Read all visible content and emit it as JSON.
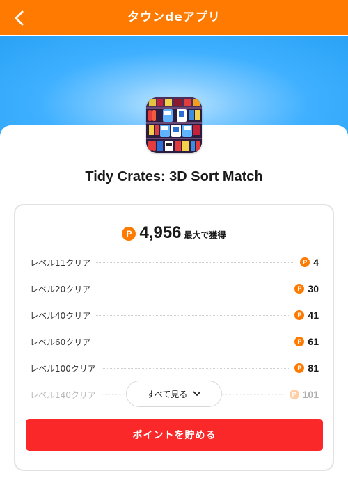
{
  "header": {
    "title": "タウンdeアプリ",
    "back_icon": "chevron-left-icon",
    "color": "#ff7a00"
  },
  "app": {
    "name": "Tidy Crates: 3D Sort Match",
    "icon": "app-icon"
  },
  "reward": {
    "total": "4,956",
    "total_suffix": "最大で獲得",
    "coin_label": "P",
    "coin_color": "#ff7a00",
    "items": [
      {
        "label": "レベル11クリア",
        "points": "4"
      },
      {
        "label": "レベル20クリア",
        "points": "30"
      },
      {
        "label": "レベル40クリア",
        "points": "41"
      },
      {
        "label": "レベル60クリア",
        "points": "61"
      },
      {
        "label": "レベル100クリア",
        "points": "81"
      },
      {
        "label": "レベル140クリア",
        "points": "101"
      }
    ]
  },
  "actions": {
    "see_all": "すべて見る",
    "save": "ポイントを貯める",
    "save_color": "#fa2828"
  }
}
